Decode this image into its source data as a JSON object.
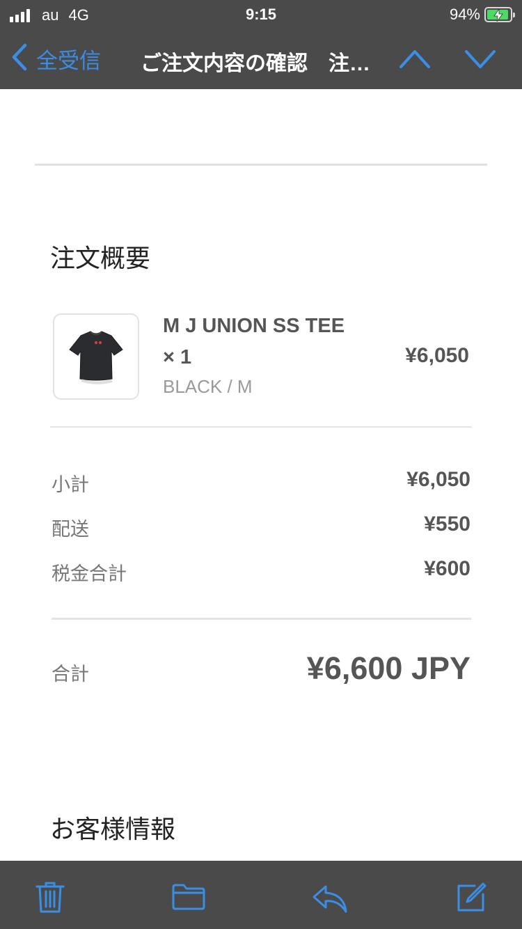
{
  "status_bar": {
    "carrier": "au",
    "network": "4G",
    "time": "9:15",
    "battery": "94%",
    "battery_level": 0.94,
    "icons": [
      "signal-icon",
      "battery-charging-icon"
    ]
  },
  "nav": {
    "back_label": "全受信",
    "title": "ご注文内容の確認　注…",
    "icons": [
      "chevron-left-icon",
      "chevron-up-icon",
      "chevron-down-icon"
    ]
  },
  "order_summary": {
    "heading": "注文概要",
    "item": {
      "name": "M J UNION SS TEE × 1",
      "variant": "BLACK / M",
      "price": "¥6,050"
    },
    "rows": [
      {
        "label": "小計",
        "value": "¥6,050"
      },
      {
        "label": "配送",
        "value": "¥550"
      },
      {
        "label": "税金合計",
        "value": "¥600"
      }
    ],
    "total_label": "合計",
    "total_value": "¥6,600 JPY"
  },
  "customer_info": {
    "heading": "お客様情報"
  },
  "toolbar": {
    "icons": [
      "trash-icon",
      "folder-icon",
      "reply-icon",
      "compose-icon"
    ]
  },
  "colors": {
    "accent": "#3a8ee6",
    "bar_background": "#4a4a4a",
    "battery_fill": "#4cd964"
  }
}
